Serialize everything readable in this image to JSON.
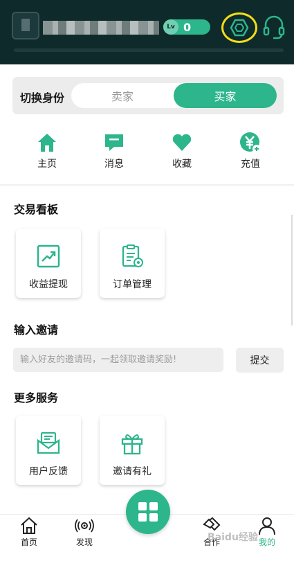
{
  "header": {
    "level_label": "Lv",
    "level_value": "0",
    "settings_icon": "settings-hexagon-icon",
    "support_icon": "headset-icon",
    "highlight_color": "#f1dd19"
  },
  "role_switch": {
    "title": "切换身份",
    "options": [
      "卖家",
      "买家"
    ],
    "selected": "买家"
  },
  "quick_nav": [
    {
      "label": "主页",
      "icon": "home-icon"
    },
    {
      "label": "消息",
      "icon": "message-icon"
    },
    {
      "label": "收藏",
      "icon": "heart-icon"
    },
    {
      "label": "充值",
      "icon": "recharge-icon"
    }
  ],
  "trade_board": {
    "title": "交易看板",
    "cards": [
      {
        "label": "收益提现",
        "icon": "chart-trend-icon"
      },
      {
        "label": "订单管理",
        "icon": "clipboard-gear-icon"
      }
    ]
  },
  "invite": {
    "title": "输入邀请",
    "placeholder": "输入好友的邀请码，一起领取邀请奖励!",
    "submit_label": "提交"
  },
  "more_services": {
    "title": "更多服务",
    "cards": [
      {
        "label": "用户反馈",
        "icon": "mail-feedback-icon"
      },
      {
        "label": "邀请有礼",
        "icon": "gift-icon"
      }
    ]
  },
  "bottom_nav": [
    {
      "label": "首页",
      "icon": "home-outline-icon"
    },
    {
      "label": "发现",
      "icon": "radar-icon"
    },
    {
      "label": "合作",
      "icon": "handshake-icon"
    },
    {
      "label": "我的",
      "icon": "user-icon",
      "active": true
    }
  ],
  "watermark": "Baidu经验",
  "colors": {
    "accent": "#2db58c",
    "header_bg": "#0f2a2b"
  }
}
